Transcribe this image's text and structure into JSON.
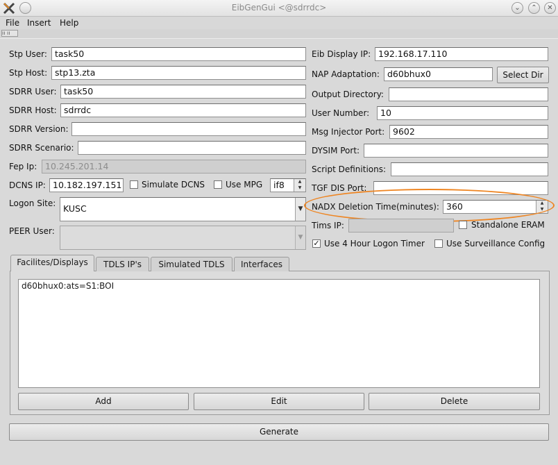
{
  "window": {
    "title": "EibGenGui <@sdrrdc>"
  },
  "menu": {
    "file": "File",
    "insert": "Insert",
    "help": "Help"
  },
  "left": {
    "stp_user_label": "Stp User:",
    "stp_user_value": "task50",
    "stp_host_label": "Stp Host:",
    "stp_host_value": "stp13.zta",
    "sdrr_user_label": "SDRR User:",
    "sdrr_user_value": "task50",
    "sdrr_host_label": "SDRR Host:",
    "sdrr_host_value": "sdrrdc",
    "sdrr_version_label": "SDRR Version:",
    "sdrr_version_value": "",
    "sdrr_scenario_label": "SDRR Scenario:",
    "sdrr_scenario_value": "",
    "fep_ip_label": "Fep Ip:",
    "fep_ip_value": "10.245.201.14",
    "dcns_ip_label": "DCNS IP:",
    "dcns_ip_value": "10.182.197.151",
    "simulate_dcns_label": "Simulate DCNS",
    "simulate_dcns_checked": false,
    "use_mpg_label": "Use MPG",
    "use_mpg_checked": false,
    "interface_value": "if8",
    "logon_site_label": "Logon Site:",
    "logon_site_value": "KUSC",
    "peer_user_label": "PEER User:",
    "peer_user_value": ""
  },
  "right": {
    "eib_display_ip_label": "Eib Display IP:",
    "eib_display_ip_value": "192.168.17.110",
    "nap_adaptation_label": "NAP Adaptation:",
    "nap_adaptation_value": "d60bhux0",
    "select_dir_label": "Select Dir",
    "output_directory_label": "Output Directory:",
    "output_directory_value": "",
    "user_number_label": "User Number:",
    "user_number_value": "10",
    "msg_injector_port_label": "Msg Injector Port:",
    "msg_injector_port_value": "9602",
    "dysim_port_label": "DYSIM Port:",
    "dysim_port_value": "",
    "script_definitions_label": "Script Definitions:",
    "script_definitions_value": "",
    "tgf_dis_port_label": "TGF DIS Port:",
    "tgf_dis_port_value": "",
    "nadx_deletion_label": "NADX Deletion Time(minutes):",
    "nadx_deletion_value": "360",
    "tims_ip_label": "Tims IP:",
    "tims_ip_value": "",
    "standalone_eram_label": "Standalone ERAM",
    "standalone_eram_checked": false,
    "use_4hour_label": "Use 4 Hour Logon Timer",
    "use_4hour_checked": true,
    "use_surveillance_label": "Use Surveillance Config",
    "use_surveillance_checked": false
  },
  "tabs": [
    {
      "label": "Facilites/Displays",
      "active": true
    },
    {
      "label": "TDLS IP's",
      "active": false
    },
    {
      "label": "Simulated TDLS",
      "active": false
    },
    {
      "label": "Interfaces",
      "active": false
    }
  ],
  "facilities_list": [
    "d60bhux0:ats=S1:BOI"
  ],
  "buttons": {
    "add": "Add",
    "edit": "Edit",
    "delete": "Delete",
    "generate": "Generate"
  },
  "colors": {
    "highlight": "#ee8522"
  }
}
